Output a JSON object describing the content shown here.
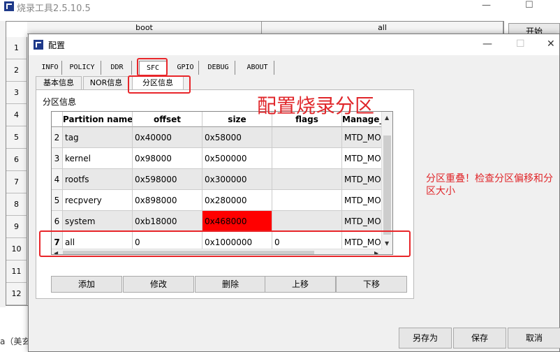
{
  "main_window": {
    "title": "烧录工具2.5.10.5",
    "grid_headers": [
      "boot",
      "all"
    ],
    "row_numbers": [
      "1",
      "2",
      "3",
      "4",
      "5",
      "6",
      "7",
      "8",
      "9",
      "10",
      "11",
      "12"
    ],
    "start_button": "开始",
    "status_fragment": "a（美玄"
  },
  "dialog": {
    "title": "配置",
    "tabs": [
      "INFO",
      "POLICY",
      "DDR",
      "SFC",
      "GPIO",
      "DEBUG",
      "ABOUT"
    ],
    "active_tab": "SFC",
    "sub_tabs": [
      "基本信息",
      "NOR信息",
      "分区信息"
    ],
    "active_sub_tab": "分区信息",
    "group_label": "分区信息",
    "table": {
      "columns": [
        "Partition name",
        "offset",
        "size",
        "flags",
        "Manage_mo"
      ],
      "rows": [
        {
          "num": "2",
          "name": "tag",
          "offset": "0x40000",
          "size": "0x58000",
          "flags": "",
          "manage": "MTD_MODE"
        },
        {
          "num": "3",
          "name": "kernel",
          "offset": "0x98000",
          "size": "0x500000",
          "flags": "",
          "manage": "MTD_MODE"
        },
        {
          "num": "4",
          "name": "rootfs",
          "offset": "0x598000",
          "size": "0x300000",
          "flags": "",
          "manage": "MTD_MODE"
        },
        {
          "num": "5",
          "name": "recpvery",
          "offset": "0x898000",
          "size": "0x280000",
          "flags": "",
          "manage": "MTD_MODE"
        },
        {
          "num": "6",
          "name": "system",
          "offset": "0xb18000",
          "size": "0x468000",
          "flags": "",
          "manage": "MTD_MODE"
        },
        {
          "num": "7",
          "name": "all",
          "offset": "0",
          "size": "0x1000000",
          "flags": "0",
          "manage": "MTD_MODE"
        }
      ],
      "highlight_color": "#ff0000"
    },
    "actions": [
      "添加",
      "修改",
      "删除",
      "上移",
      "下移"
    ],
    "footer": [
      "另存为",
      "保存",
      "取消"
    ]
  },
  "annotations": {
    "heading": "配置烧录分区",
    "note": "分区重叠！检查分区偏移和分区大小",
    "color": "#e0262a"
  }
}
